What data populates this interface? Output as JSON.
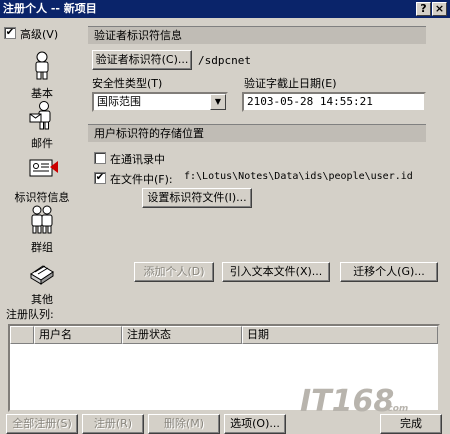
{
  "window": {
    "title": "注册个人 -- 新项目",
    "help_glyph": "?",
    "close_glyph": "×"
  },
  "sidebar": {
    "advanced_label": "高级(V)",
    "advanced_checked": true,
    "items": [
      {
        "label": "基本",
        "icon": "person-icon"
      },
      {
        "label": "邮件",
        "icon": "mail-person-icon"
      },
      {
        "label": "标识符信息",
        "icon": "id-card-icon",
        "active": true
      },
      {
        "label": "群组",
        "icon": "group-icon"
      },
      {
        "label": "其他",
        "icon": "other-icon"
      }
    ]
  },
  "certifier": {
    "section_label": "验证者标识符信息",
    "button_label": "验证者标识符(C)...",
    "value": "/sdpcnet"
  },
  "security": {
    "label": "安全性类型(T)",
    "selected": "国际范围",
    "expiry_label": "验证字截止日期(E)",
    "expiry_value": "2103-05-28 14:55:21"
  },
  "storage": {
    "section_label": "用户标识符的存储位置",
    "in_directory_label": "在通讯录中",
    "in_directory_checked": false,
    "in_file_label": "在文件中(F):",
    "in_file_checked": true,
    "file_path": "f:\\Lotus\\Notes\\Data\\ids\\people\\user.id",
    "set_file_button": "设置标识符文件(I)..."
  },
  "actions": {
    "add_person": "添加个人(D)",
    "import_text": "引入文本文件(X)...",
    "migrate_person": "迁移个人(G)..."
  },
  "queue": {
    "label": "注册队列:",
    "columns": [
      "用户名",
      "注册状态",
      "日期"
    ]
  },
  "footer": {
    "register_all": "全部注册(S)",
    "register": "注册(R)",
    "delete": "删除(M)",
    "options": "选项(O)...",
    "done": "完成"
  },
  "watermark": "IT168.com",
  "colors": {
    "title_bg": "#0a246a",
    "window_bg": "#d4d0c8",
    "active_marker": "#cc0000"
  }
}
